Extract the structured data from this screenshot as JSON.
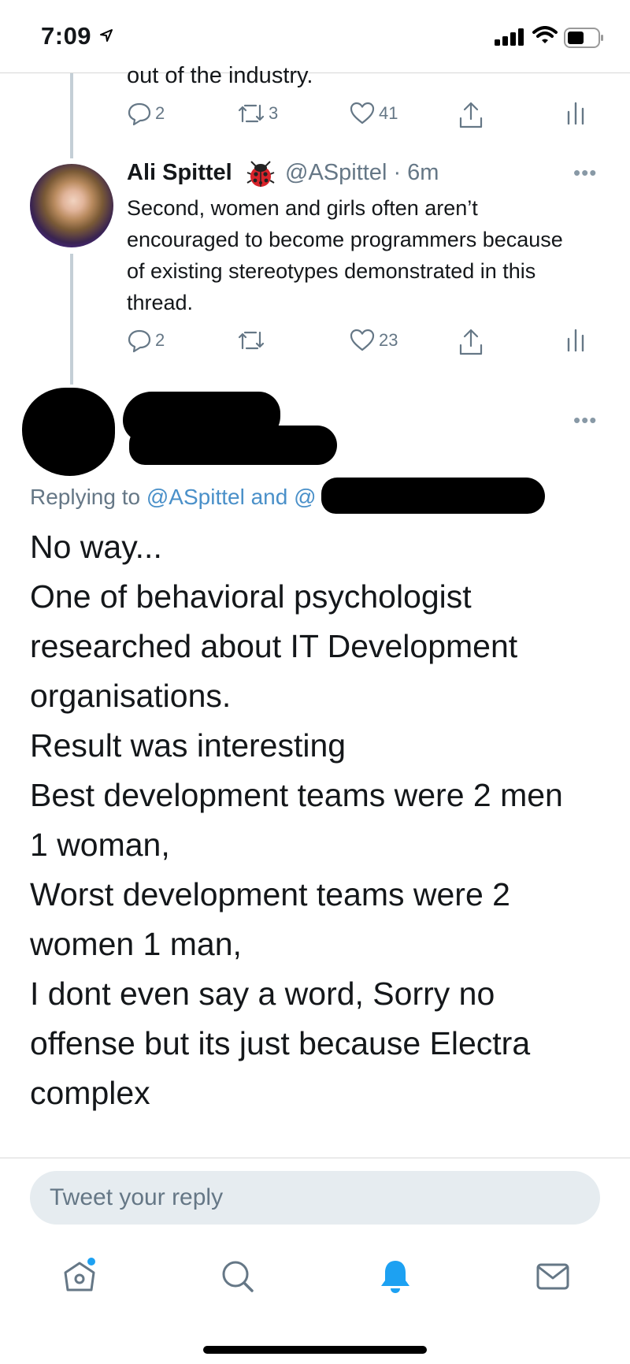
{
  "status_bar": {
    "time": "7:09"
  },
  "previous_tweet": {
    "cut_text": "out of the industry.",
    "actions": {
      "replies": "2",
      "retweets": "3",
      "likes": "41"
    }
  },
  "tweet": {
    "name": "Ali Spittel",
    "handle_time": "@ASpittel · 6m",
    "text": "Second, women and girls often aren’t encouraged to become programmers because of existing stereotypes demonstrated in this thread.",
    "actions": {
      "replies": "2",
      "retweets": "",
      "likes": "23"
    }
  },
  "reply": {
    "replying_prefix": "Replying to ",
    "replying_link": "@ASpittel and @",
    "lines": [
      "No way...",
      "One of behavioral psychologist",
      "researched about IT Development",
      "organisations.",
      "Result was interesting",
      "Best development teams were 2 men",
      "1 woman,",
      "Worst development teams were 2",
      "women 1 man,",
      "I dont even say a word, Sorry no",
      "offense but its just because Electra",
      "complex"
    ]
  },
  "composer": {
    "placeholder": "Tweet your reply"
  },
  "icons": {
    "more": "more-icon",
    "reply": "reply-icon",
    "retweet": "retweet-icon",
    "like": "like-icon",
    "share": "share-icon",
    "analytics": "analytics-icon",
    "tabs": [
      "home-icon",
      "search-icon",
      "notifications-icon",
      "messages-icon"
    ]
  },
  "colors": {
    "accent": "#1da1f2",
    "secondary_text": "#657786",
    "thread_line": "#c4cfd6"
  }
}
